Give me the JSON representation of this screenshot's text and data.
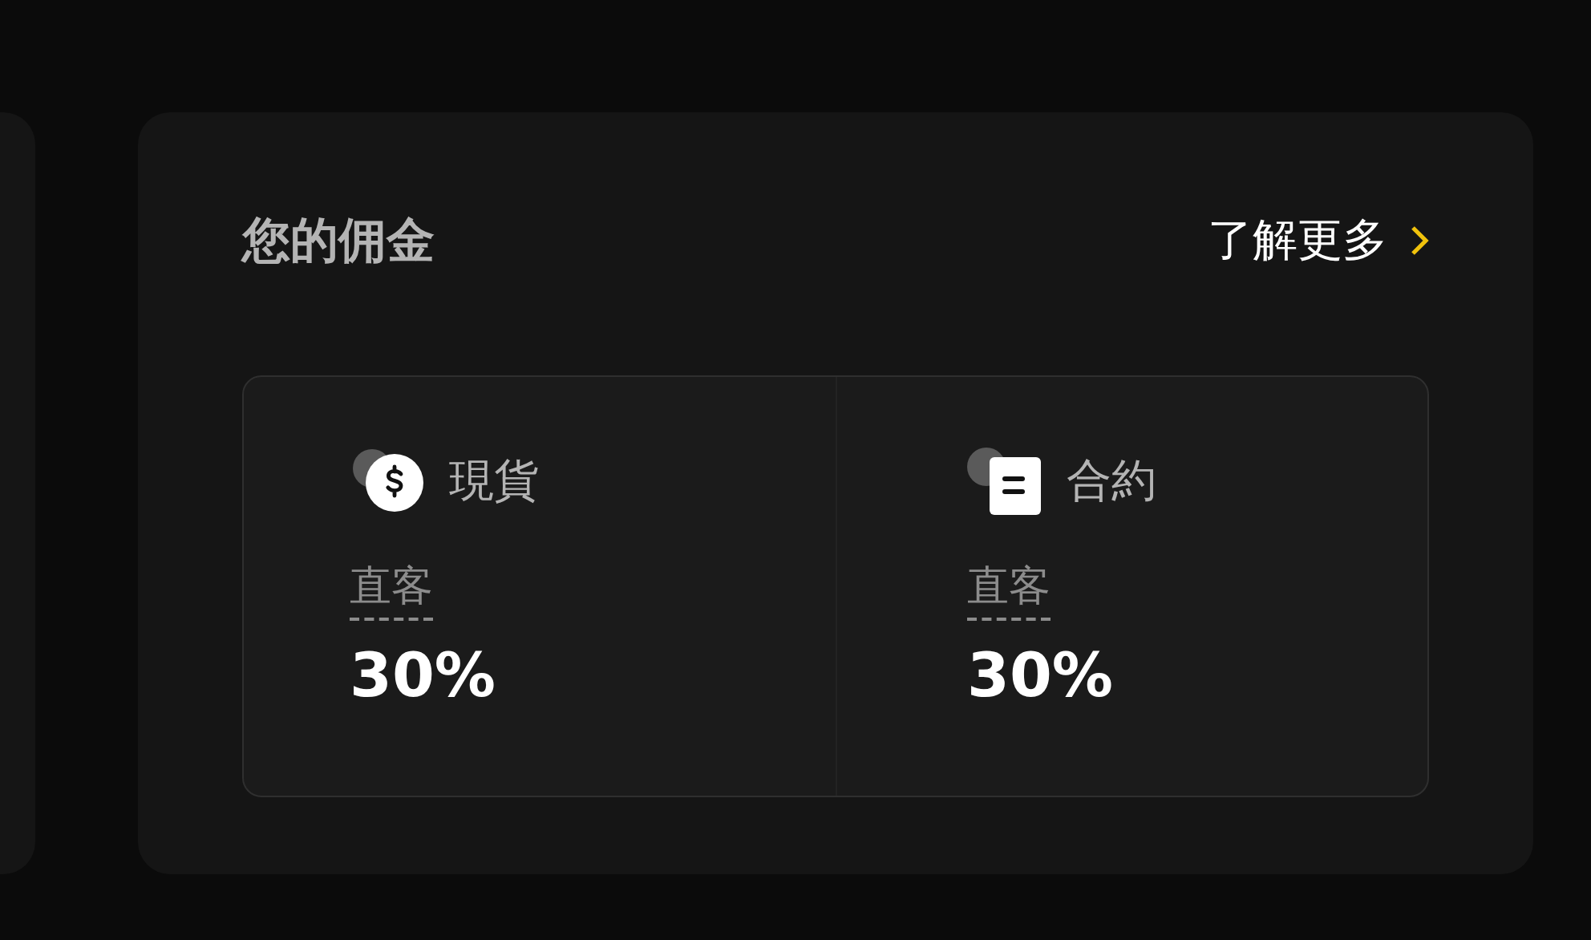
{
  "card": {
    "title": "您的佣金",
    "link": "了解更多"
  },
  "columns": [
    {
      "kind": "spot",
      "name": "現貨",
      "label": "直客",
      "value": "30%"
    },
    {
      "kind": "contract",
      "name": "合約",
      "label": "直客",
      "value": "30%"
    }
  ]
}
